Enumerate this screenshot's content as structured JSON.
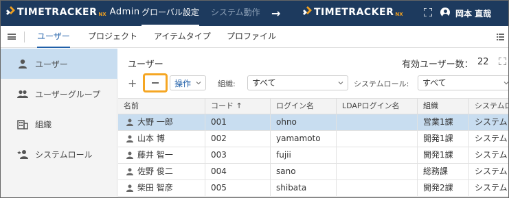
{
  "header": {
    "logo": {
      "brand": "TIMETRACKER",
      "nx": "NX",
      "suffix": "Admin"
    },
    "tabs": [
      {
        "label": "グローバル設定",
        "active": true
      },
      {
        "label": "システム動作",
        "active": false
      }
    ],
    "arrow": "→",
    "logo2": {
      "brand": "TIMETRACKER",
      "nx": "NX"
    },
    "user_name": "岡本 直哉"
  },
  "subnav": {
    "tabs": [
      {
        "label": "ユーザー",
        "active": true
      },
      {
        "label": "プロジェクト",
        "active": false
      },
      {
        "label": "アイテムタイプ",
        "active": false
      },
      {
        "label": "プロファイル",
        "active": false
      }
    ]
  },
  "sidebar": {
    "items": [
      {
        "label": "ユーザー",
        "icon": "user-icon",
        "active": true
      },
      {
        "label": "ユーザーグループ",
        "icon": "user-group-icon",
        "active": false
      },
      {
        "label": "組織",
        "icon": "building-icon",
        "active": false
      },
      {
        "label": "システムロール",
        "icon": "user-star-icon",
        "active": false
      }
    ]
  },
  "main": {
    "title": "ユーザー",
    "count_label": "有効ユーザー数：",
    "count_value": "22",
    "toolbar": {
      "add": "+",
      "ops_label": "操作",
      "org_label": "組織:",
      "org_value": "すべて",
      "role_label": "システムロール:",
      "role_value": "すべて"
    },
    "table": {
      "columns": [
        "名前",
        "コード ↑",
        "ログイン名",
        "LDAPログイン名",
        "組織",
        "システムロ"
      ],
      "rows": [
        {
          "name": "大野 一郎",
          "code": "001",
          "login": "ohno",
          "ldap": "",
          "org": "営業1課",
          "role": "システム",
          "selected": true
        },
        {
          "name": "山本 博",
          "code": "002",
          "login": "yamamoto",
          "ldap": "",
          "org": "開発1課",
          "role": "システム",
          "selected": false
        },
        {
          "name": "藤井 智一",
          "code": "003",
          "login": "fujii",
          "ldap": "",
          "org": "開発1課",
          "role": "システム",
          "selected": false
        },
        {
          "name": "佐野 俊二",
          "code": "004",
          "login": "sano",
          "ldap": "",
          "org": "総務課",
          "role": "システム",
          "selected": false
        },
        {
          "name": "柴田 智彦",
          "code": "005",
          "login": "shibata",
          "ldap": "",
          "org": "開発2課",
          "role": "システム",
          "selected": false
        }
      ]
    }
  },
  "colors": {
    "header_bg": "#1d3a5e",
    "accent": "#1f5fa8",
    "selected_row": "#c8ddf0",
    "highlight": "#f5a623",
    "nx_orange": "#f0a020"
  }
}
